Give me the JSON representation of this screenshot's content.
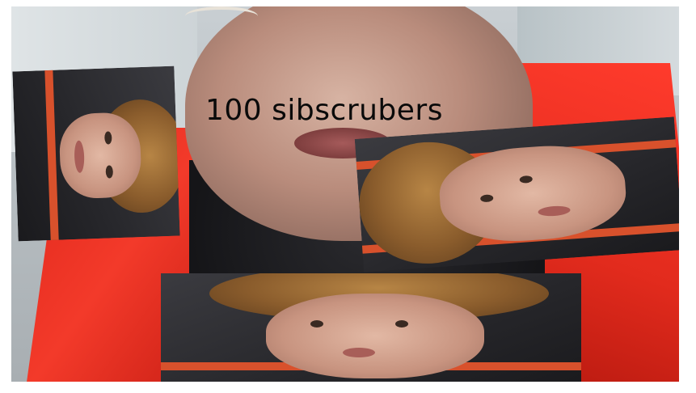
{
  "caption": {
    "text": "100 sibscrubers"
  },
  "colors": {
    "jacket_red": "#e32a1e",
    "shirt_black": "#151518",
    "hoodie_stripe": "#d8512c",
    "caption_text": "#0a0a0a"
  }
}
